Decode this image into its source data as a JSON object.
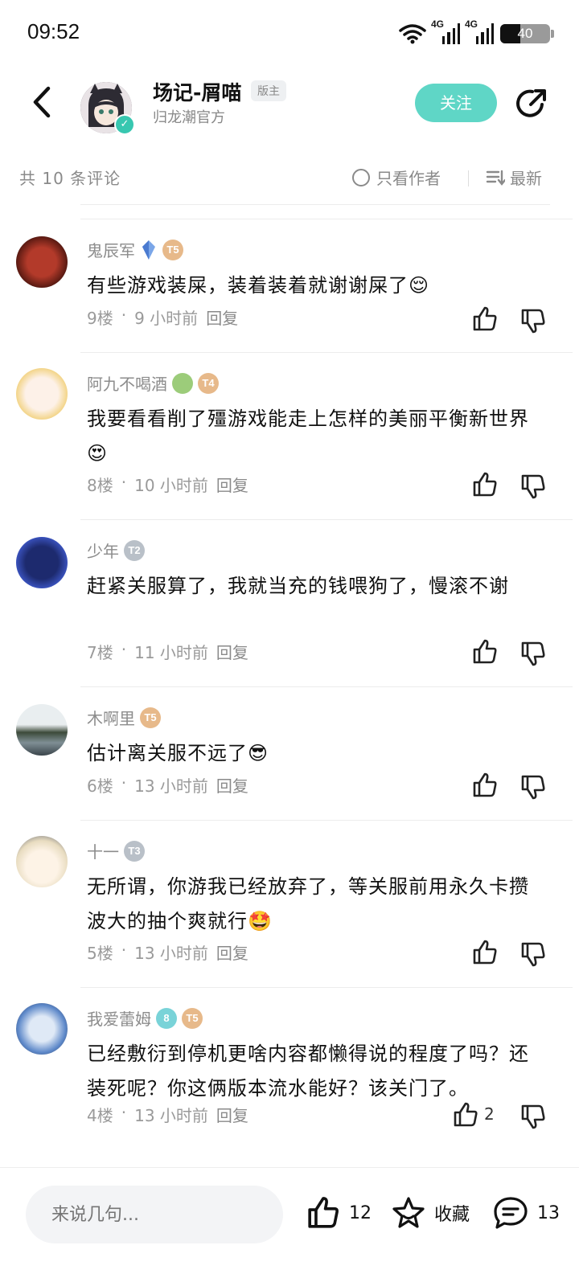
{
  "status_bar": {
    "time": "09:52",
    "network1": "4G",
    "network2": "4G",
    "battery": "40",
    "battery_level": 0.4
  },
  "header": {
    "username": "场记-屑喵",
    "role_badge": "版主",
    "subtitle": "归龙潮官方",
    "follow_label": "关注",
    "accent_color": "#5fd6c6"
  },
  "sort_bar": {
    "comment_count": "共 10 条评论",
    "author_only_label": "只看作者",
    "sort_label": "最新"
  },
  "comments": [
    {
      "name": "鬼辰军",
      "level": "T5",
      "text": "有些游戏装屎，装着装着就谢谢屎了😌",
      "floor": "9楼",
      "time": "9 小时前",
      "reply": "回复",
      "likes": ""
    },
    {
      "name": "阿九不喝酒",
      "level": "T4",
      "text": "我要看看削了殭游戏能走上怎样的美丽平衡新世界😍",
      "floor": "8楼",
      "time": "10 小时前",
      "reply": "回复",
      "likes": ""
    },
    {
      "name": "少年",
      "level": "T2",
      "text": "赶紧关服算了，我就当充的钱喂狗了，慢滚不谢",
      "floor": "7楼",
      "time": "11 小时前",
      "reply": "回复",
      "likes": ""
    },
    {
      "name": "木啊里",
      "level": "T5",
      "text": "估计离关服不远了😎",
      "floor": "6楼",
      "time": "13 小时前",
      "reply": "回复",
      "likes": ""
    },
    {
      "name": "十一",
      "level": "T3",
      "text": "无所谓，你游我已经放弃了，等关服前用永久卡攒波大的抽个爽就行🤩",
      "floor": "5楼",
      "time": "13 小时前",
      "reply": "回复",
      "likes": ""
    },
    {
      "name": "我爱蕾姆",
      "level": "T5",
      "extra_badge": "8",
      "text": "已经敷衍到停机更啥内容都懒得说的程度了吗？还装死呢？你这俩版本流水能好？该关门了。",
      "floor": "4楼",
      "time": "13 小时前",
      "reply": "回复",
      "likes": "2"
    }
  ],
  "bottom_bar": {
    "input_placeholder": "来说几句...",
    "like_count": "12",
    "collect_label": "收藏",
    "comment_count": "13"
  }
}
